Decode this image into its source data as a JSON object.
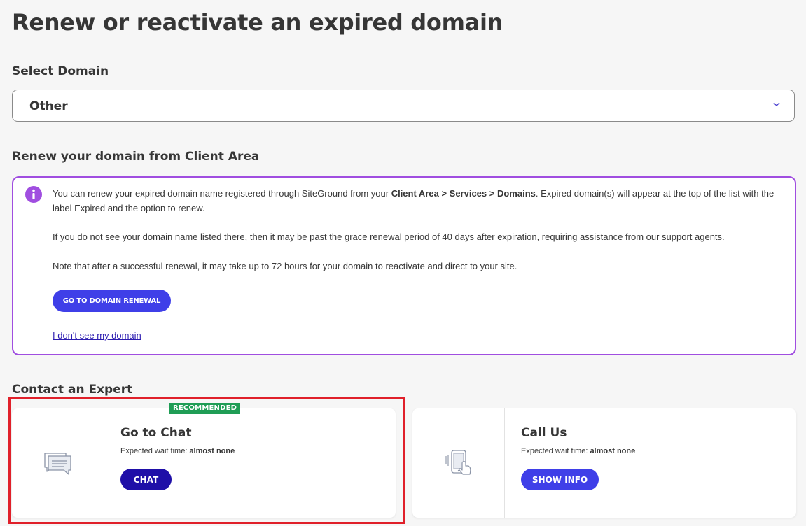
{
  "page": {
    "title": "Renew or reactivate an expired domain"
  },
  "select": {
    "label": "Select Domain",
    "value": "Other"
  },
  "renew_section": {
    "heading": "Renew your domain from Client Area",
    "p1_before": "You can renew your expired domain name registered through SiteGround from your ",
    "p1_bold": "Client Area > Services > Domains",
    "p1_after": ". Expired domain(s) will appear at the top of the list with the label Expired and the option to renew.",
    "p2": "If you do not see your domain name listed there, then it may be past the grace renewal period of 40 days after expiration, requiring assistance from our support agents.",
    "p3": "Note that after a successful renewal, it may take up to 72 hours for your domain to reactivate and direct to your site.",
    "button": "GO TO DOMAIN RENEWAL",
    "link": "I don't see my domain"
  },
  "contact": {
    "heading": "Contact an Expert",
    "chat": {
      "badge": "RECOMMENDED",
      "title": "Go to Chat",
      "wait_label": "Expected wait time: ",
      "wait_value": "almost none",
      "button": "CHAT",
      "icon": "chat-icon"
    },
    "call": {
      "title": "Call Us",
      "wait_label": "Expected wait time: ",
      "wait_value": "almost none",
      "button": "SHOW INFO",
      "icon": "phone-icon"
    }
  },
  "colors": {
    "accent": "#3f3fe8",
    "chat_button": "#1f0fa8",
    "info_border": "#a04ee0",
    "badge": "#1f9d55",
    "highlight": "#e0202a"
  }
}
